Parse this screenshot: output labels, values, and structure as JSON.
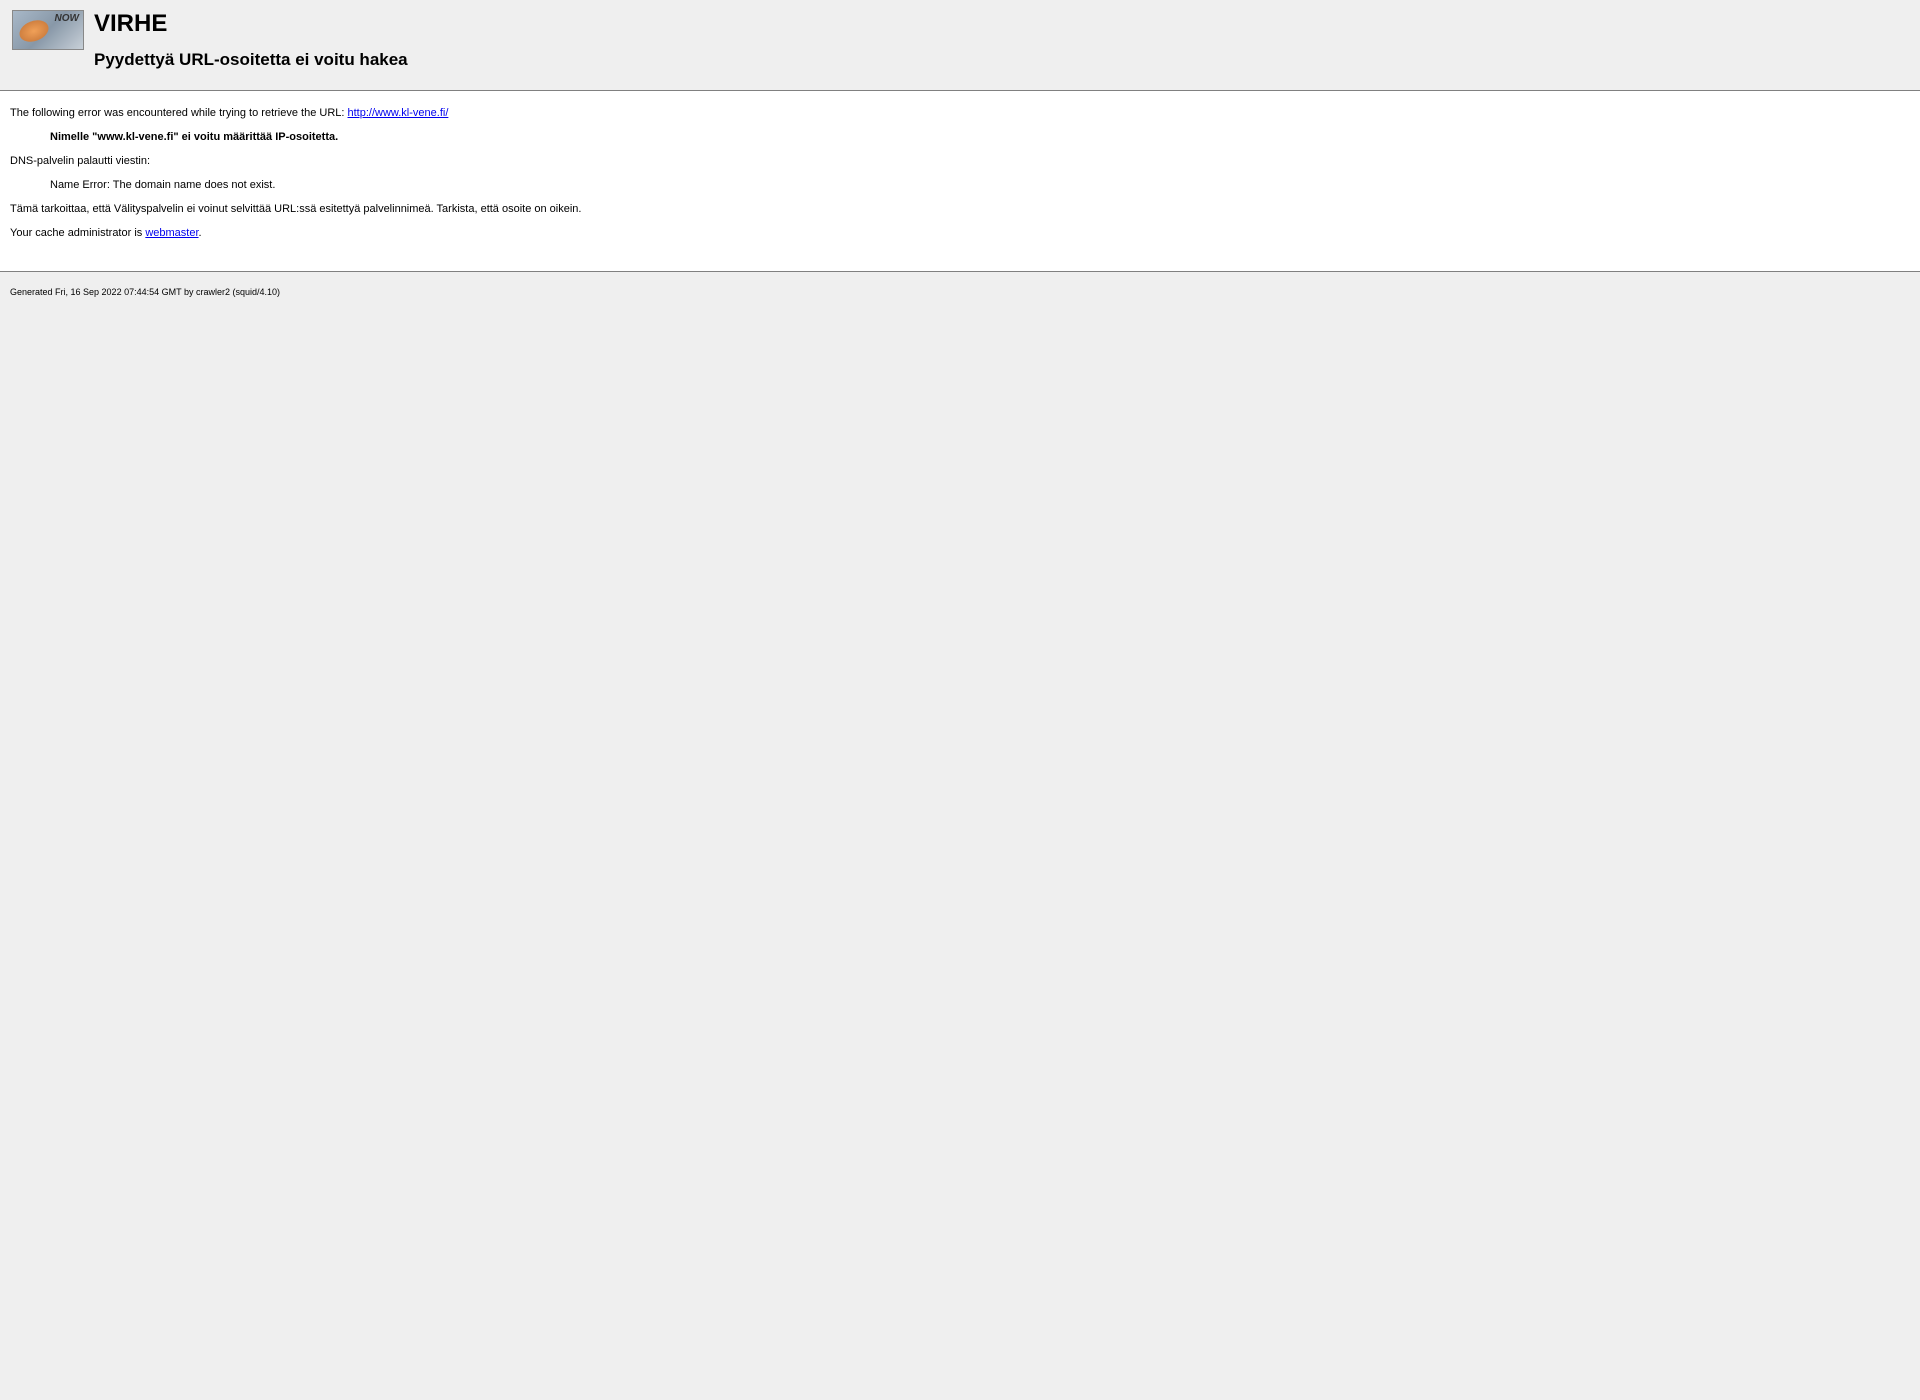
{
  "header": {
    "icon_label": "NOW",
    "title": "VIRHE",
    "subtitle": "Pyydettyä URL-osoitetta ei voitu hakea"
  },
  "content": {
    "intro_text": "The following error was encountered while trying to retrieve the URL: ",
    "url_link": "http://www.kl-vene.fi/",
    "error_bold": "Nimelle \"www.kl-vene.fi\" ei voitu määrittää IP-osoitetta.",
    "dns_text": "DNS-palvelin palautti viestin:",
    "name_error": "Name Error: The domain name does not exist.",
    "explanation": "Tämä tarkoittaa, että Välityspalvelin ei voinut selvittää URL:ssä esitettyä palvelinnimeä. Tarkista, että osoite on oikein.",
    "admin_text": "Your cache administrator is ",
    "admin_link": "webmaster",
    "admin_period": "."
  },
  "footer": {
    "generated": "Generated Fri, 16 Sep 2022 07:44:54 GMT by crawler2 (squid/4.10)"
  }
}
